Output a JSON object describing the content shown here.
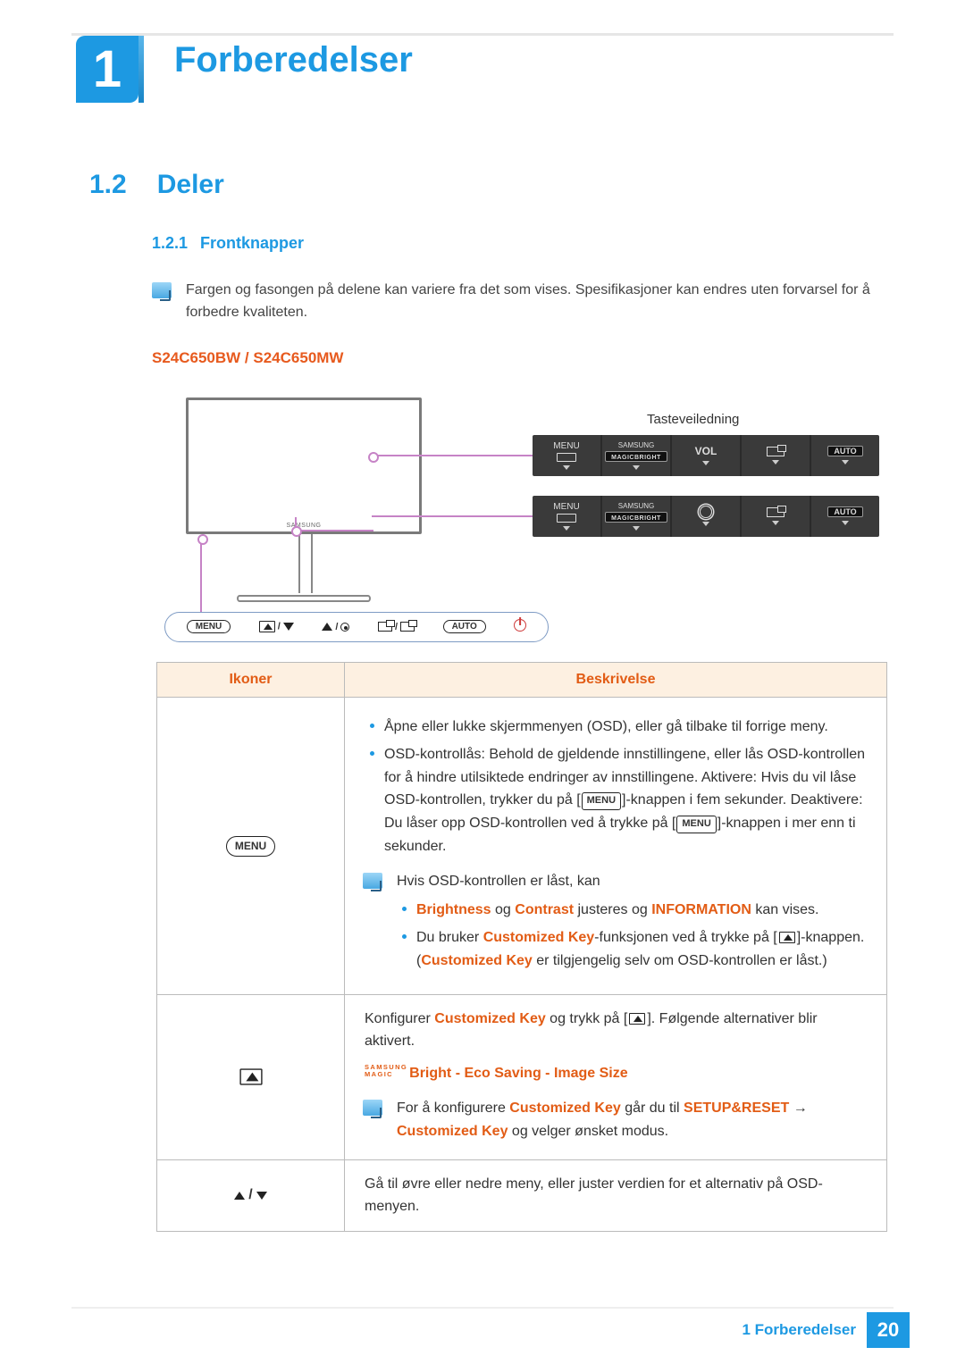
{
  "chapter": {
    "number": "1",
    "title": "Forberedelser"
  },
  "section": {
    "number": "1.2",
    "title": "Deler"
  },
  "subsection": {
    "number": "1.2.1",
    "title": "Frontknapper"
  },
  "note1": "Fargen og fasongen på delene kan variere fra det som vises. Spesifikasjoner kan endres uten forvarsel for å forbedre kvaliteten.",
  "model_heading": "S24C650BW / S24C650MW",
  "figure": {
    "monitor_brand": "SAMSUNG",
    "keyguide_label": "Tasteveiledning",
    "panel_labels": {
      "menu": "MENU",
      "samsung": "SAMSUNG",
      "magic": "MAGIC",
      "bright": "BRIGHT",
      "vol": "VOL",
      "auto": "AUTO"
    },
    "button_box": {
      "menu": "MENU",
      "auto": "AUTO"
    }
  },
  "table": {
    "headers": {
      "icons": "Ikoner",
      "desc": "Beskrivelse"
    },
    "row1": {
      "icon_label": "MENU",
      "b1": "Åpne eller lukke skjermmenyen (OSD), eller gå tilbake til forrige meny.",
      "b2a": "OSD-kontrollås: Behold de gjeldende innstillingene, eller lås OSD-kontrollen for å hindre utilsiktede endringer av innstillingene. Aktivere: Hvis du vil låse OSD-kontrollen, trykker du på [",
      "b2b": "]-knappen i fem sekunder. Deaktivere: Du låser opp OSD-kontrollen ved å trykke på [",
      "b2c": "]-knappen i mer enn ti sekunder.",
      "menu_chip": "MENU",
      "info_intro": "Hvis OSD-kontrollen er låst, kan",
      "sub_b1_pre": "Brightness",
      "sub_b1_mid": " og ",
      "sub_b1_c": "Contrast",
      "sub_b1_mid2": " justeres og ",
      "sub_b1_info": "INFORMATION",
      "sub_b1_post": " kan vises.",
      "sub_b2_pre": "Du bruker ",
      "sub_b2_ck": "Customized Key",
      "sub_b2_mid": "-funksjonen ved å trykke på [",
      "sub_b2_post": "]-knappen. (",
      "sub_b2_ck2": "Customized Key",
      "sub_b2_post2": " er tilgjengelig selv om OSD-kontrollen er låst.)"
    },
    "row2": {
      "p_pre": "Konfigurer ",
      "p_ck": "Customized Key",
      "p_mid": " og trykk på [",
      "p_post": "]. Følgende alternativer blir aktivert.",
      "options": {
        "sm1": "SAMSUNG",
        "sm2": "MAGIC",
        "o1": "Bright",
        "sep": " - ",
        "o2": "Eco Saving",
        "o3": "Image Size"
      },
      "info_pre": "For å konfigurere ",
      "info_ck": "Customized Key",
      "info_mid": " går du til ",
      "info_sr": "SETUP&RESET",
      "info_arrow": "  →  ",
      "info_ck2": "Customized Key",
      "info_post": " og velger ønsket modus."
    },
    "row3": {
      "text": "Gå til øvre eller nedre meny, eller juster verdien for et alternativ på OSD-menyen."
    }
  },
  "footer": {
    "label": "1 Forberedelser",
    "page": "20"
  }
}
